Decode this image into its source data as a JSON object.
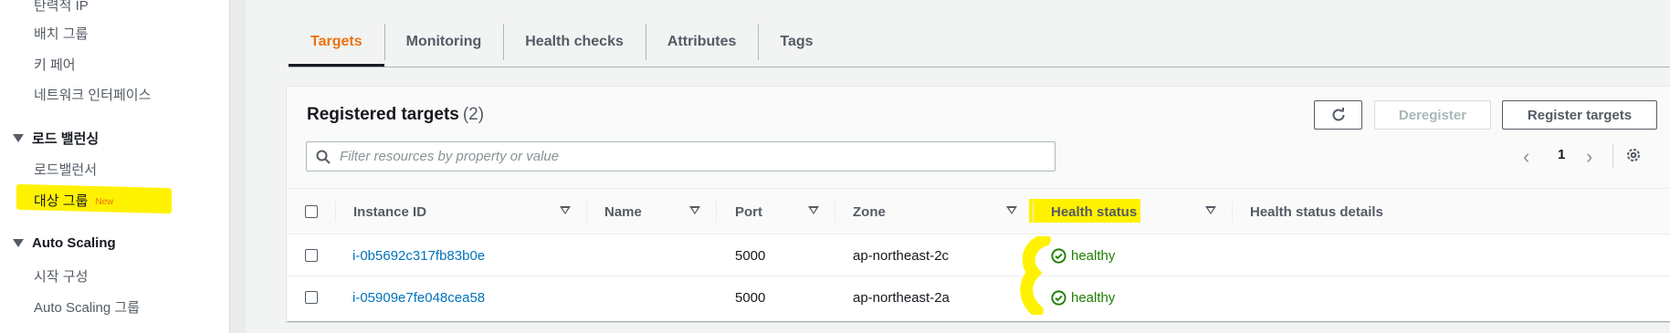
{
  "sidebar": {
    "items_top": [
      "탄력적 IP",
      "배치 그룹",
      "키 페어",
      "네트워크 인터페이스"
    ],
    "section_lb": "로드 밸런싱",
    "lb_items": [
      "로드밸런서",
      "대상 그룹"
    ],
    "new_badge": "New",
    "section_as": "Auto Scaling",
    "as_items": [
      "시작 구성",
      "Auto Scaling 그룹"
    ]
  },
  "tabs": [
    {
      "label": "Targets",
      "active": true
    },
    {
      "label": "Monitoring"
    },
    {
      "label": "Health checks"
    },
    {
      "label": "Attributes"
    },
    {
      "label": "Tags"
    }
  ],
  "panel": {
    "title": "Registered targets",
    "count": "(2)",
    "deregister_label": "Deregister",
    "register_label": "Register targets",
    "filter_placeholder": "Filter resources by property or value",
    "page": "1"
  },
  "table": {
    "columns": [
      "Instance ID",
      "Name",
      "Port",
      "Zone",
      "Health status",
      "Health status details"
    ],
    "rows": [
      {
        "instance_id": "i-0b5692c317fb83b0e",
        "name": "",
        "port": "5000",
        "zone": "ap-northeast-2c",
        "health": "healthy",
        "details": ""
      },
      {
        "instance_id": "i-05909e7fe048cea58",
        "name": "",
        "port": "5000",
        "zone": "ap-northeast-2a",
        "health": "healthy",
        "details": ""
      }
    ]
  },
  "colors": {
    "accent": "#ec7211",
    "link": "#0073bb",
    "healthy": "#1d8102",
    "highlight": "#fff200"
  }
}
